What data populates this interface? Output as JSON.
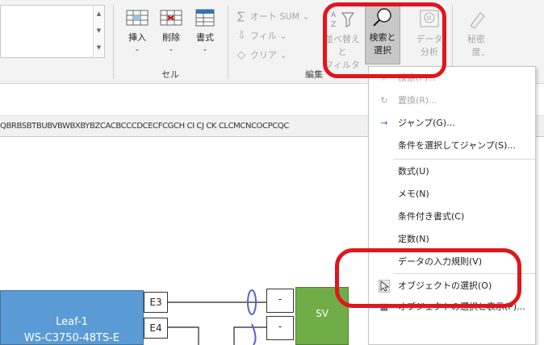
{
  "ribbon": {
    "cells_group": {
      "label": "セル",
      "insert": "挿入",
      "delete": "削除",
      "format": "書式"
    },
    "edit_group": {
      "label": "編集",
      "autosum": "オート SUM",
      "fill": "フィル",
      "clear": "クリア",
      "sort_filter": [
        "並べ替えと",
        "フィルター"
      ],
      "find_select": [
        "検索と",
        "選択"
      ]
    },
    "analysis": [
      "データ",
      "分析"
    ],
    "sensitivity": [
      "秘密",
      "度"
    ]
  },
  "column_headers": "QBRBSBTBUBVBWBXBYBZCACBCCCDCECFCGCH CI CJ CK CLCMCNCOCPCQC",
  "diagram": {
    "leaf_name": "Leaf-1",
    "leaf_model": "WS-C3750-48TS-E",
    "port_e3": "E3",
    "port_e4": "E4",
    "dash1": "-",
    "dash2": "-",
    "server": "SV"
  },
  "menu": {
    "find": "検索(F)...",
    "replace": "置換(R)...",
    "goto": "ジャンプ(G)...",
    "goto_special": "条件を選択してジャンプ(S)...",
    "formulas": "数式(U)",
    "notes": "メモ(N)",
    "conditional_formatting": "条件付き書式(C)",
    "constants": "定数(N)",
    "data_validation": "データの入力規則(V)",
    "select_objects": "オブジェクトの選択(O)",
    "selection_pane": "オブジェクトの選択と表示(P)..."
  },
  "colors": {
    "highlight": "#e0161c",
    "leaf_fill": "#5b9bd5",
    "server_fill": "#70ad47"
  }
}
